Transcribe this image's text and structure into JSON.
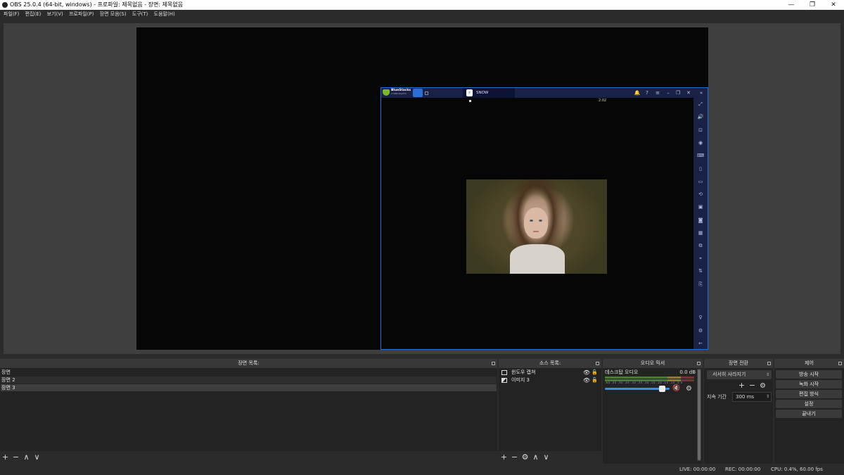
{
  "window": {
    "title": "OBS 25.0.4 (64-bit, windows) - 프로파일: 제목없음 - 장면: 제목없음",
    "minimize_glyph": "—",
    "restore_glyph": "❐",
    "close_glyph": "✕"
  },
  "menu": [
    "파일(F)",
    "편집(E)",
    "보기(V)",
    "프로파일(P)",
    "장면 모음(S)",
    "도구(T)",
    "도움말(H)"
  ],
  "preview": {
    "bluestacks": {
      "brand": "BlueStacks",
      "brand_sub": "4 SPECIALISTS",
      "app_tab_title": "SNOW",
      "app_icon": "⚡",
      "time": "2:02",
      "accent": "#1e6fd9",
      "titlebar_icons": [
        "bell-icon",
        "help-icon",
        "menu-icon",
        "minimize-icon",
        "restore-icon",
        "close-icon",
        "collapse-icon"
      ],
      "titlebar_glyphs": [
        "🔔",
        "?",
        "≡",
        "–",
        "❐",
        "✕",
        "«"
      ],
      "sidebar_icons": [
        "fullscreen-icon",
        "volume-icon",
        "keymap-icon",
        "eye-icon",
        "keyboard-icon",
        "phone-icon",
        "blank1",
        "rotate-icon",
        "screenshot-icon",
        "record-icon",
        "media-icon",
        "multi-instance-icon",
        "location-icon",
        "shake-icon",
        "copy-icon",
        "blank2",
        "bulb-icon",
        "settings-icon",
        "back-icon"
      ],
      "sidebar_glyphs": [
        "⤢",
        "🔊",
        "⊡",
        "◉",
        "⌨",
        "▯",
        "▭",
        "⟲",
        "▣",
        "◙",
        "▦",
        "⧉",
        "⌖",
        "⇅",
        "⎘",
        "",
        "♀",
        "⚙",
        "←"
      ]
    }
  },
  "scenes": {
    "header": "장면 목록:",
    "items": [
      "장면",
      "장면 2",
      "장면 3"
    ],
    "selected_index": 2,
    "toolbar": [
      "+",
      "−",
      "∧",
      "∨"
    ]
  },
  "sources": {
    "header": "소스 목록:",
    "items": [
      {
        "label": "윈도우 캡쳐",
        "visible_glyph": "👁",
        "lock_glyph": "🔓"
      },
      {
        "label": "이미지 3",
        "visible_glyph": "👁",
        "lock_glyph": "🔓"
      }
    ],
    "toolbar": [
      "+",
      "−",
      "⚙",
      "∧",
      "∨"
    ]
  },
  "mixer": {
    "header": "오디오 믹서",
    "channel": "데스크탑 오디오",
    "db": "0.0 dB",
    "ticks": "-60 -55 -50 -45 -40 -35 -30 -25 -20 -15 -10 -5 0",
    "mute_glyph": "🔇",
    "gear_glyph": "⚙",
    "volume_level": 0.92
  },
  "transitions": {
    "header": "장면 전환",
    "selected": "서서히 사라지기",
    "duration_label": "지속 기간",
    "duration_value": "300 ms",
    "toolbar": [
      "+",
      "−",
      "⚙"
    ]
  },
  "controls": {
    "header": "제어",
    "buttons": [
      "방송 시작",
      "녹화 시작",
      "편집 방식",
      "설정",
      "끝내기"
    ]
  },
  "status": {
    "live": "LIVE: 00:00:00",
    "rec": "REC: 00:00:00",
    "cpu": "CPU: 0.4%, 60.00 fps"
  }
}
